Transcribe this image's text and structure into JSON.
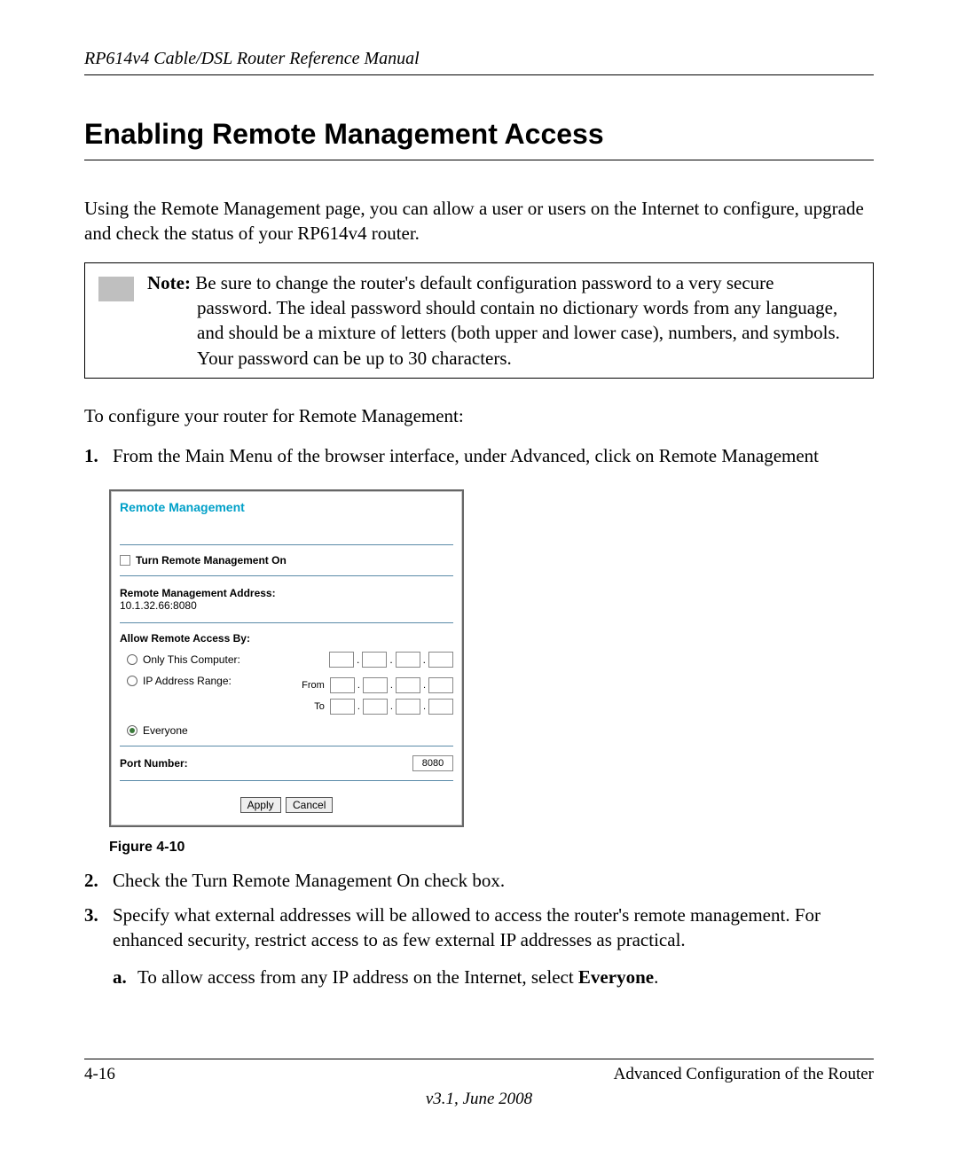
{
  "running_header": "RP614v4 Cable/DSL Router Reference Manual",
  "section_title": "Enabling Remote Management Access",
  "intro_para": "Using the Remote Management page, you can allow a user or users on the Internet to configure, upgrade and check the status of your RP614v4 router.",
  "note": {
    "label": "Note:",
    "first_line": " Be sure to change the router's default configuration password to a very secure",
    "cont": "password. The ideal password should contain no dictionary words from any language, and should be a mixture of letters (both upper and lower case), numbers, and symbols. Your password can be up to 30 characters."
  },
  "config_intro": "To configure your router for Remote Management:",
  "step1": {
    "num": "1.",
    "text": "From the Main Menu of the browser interface, under Advanced, click on Remote Management"
  },
  "panel": {
    "title": "Remote Management",
    "turn_on": "Turn Remote Management On",
    "addr_label": "Remote Management Address:",
    "addr_value": "10.1.32.66:8080",
    "allow_label": "Allow Remote Access By:",
    "only_this": "Only This Computer:",
    "ip_range": "IP Address Range:",
    "from": "From",
    "to": "To",
    "everyone": "Everyone",
    "port_label": "Port Number:",
    "port_value": "8080",
    "apply": "Apply",
    "cancel": "Cancel"
  },
  "figure_caption": "Figure 4-10",
  "step2": {
    "num": "2.",
    "text": "Check the Turn Remote Management On check box."
  },
  "step3": {
    "num": "3.",
    "text": "Specify what external addresses will be allowed to access the router's remote management. For enhanced security, restrict access to as few external IP addresses as practical."
  },
  "step3a": {
    "num": "a.",
    "pre": "To allow access from any IP address on the Internet, select ",
    "bold": "Everyone",
    "post": "."
  },
  "footer": {
    "page": "4-16",
    "chapter": "Advanced Configuration of the Router",
    "version": "v3.1, June 2008"
  }
}
